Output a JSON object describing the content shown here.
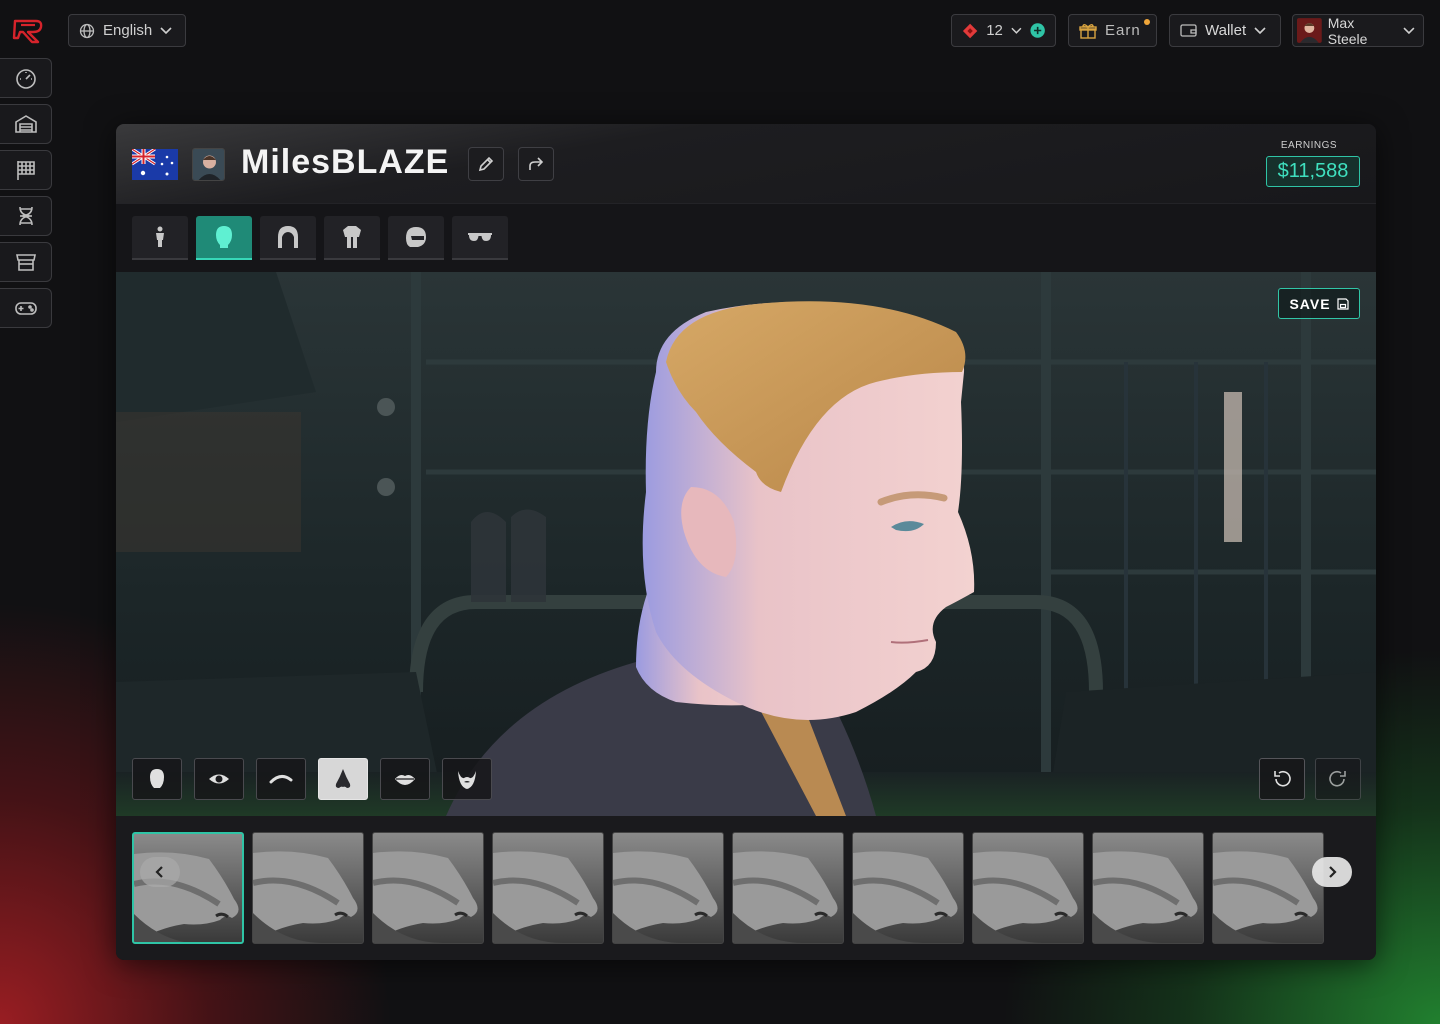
{
  "language": {
    "label": "English"
  },
  "tickets": {
    "count": "12"
  },
  "earn_button": {
    "label": "Earn"
  },
  "wallet_button": {
    "label": "Wallet"
  },
  "user": {
    "name": "Max Steele"
  },
  "profile": {
    "name": "MilesBLAZE",
    "earnings_label": "EARNINGS",
    "earnings_value": "$11,588"
  },
  "sidebar": {
    "items": [
      {
        "icon": "dashboard-gauge-icon"
      },
      {
        "icon": "garage-icon"
      },
      {
        "icon": "racing-flag-icon"
      },
      {
        "icon": "dna-icon"
      },
      {
        "icon": "store-icon"
      },
      {
        "icon": "gamepad-icon"
      }
    ]
  },
  "category_tabs": [
    {
      "icon": "body-icon",
      "active": false
    },
    {
      "icon": "head-icon",
      "active": true
    },
    {
      "icon": "hair-icon",
      "active": false
    },
    {
      "icon": "suit-icon",
      "active": false
    },
    {
      "icon": "helmet-icon",
      "active": false
    },
    {
      "icon": "glasses-icon",
      "active": false
    }
  ],
  "viewport": {
    "save_label": "SAVE"
  },
  "face_parts": [
    {
      "icon": "face-shape-icon",
      "active": false
    },
    {
      "icon": "eye-icon",
      "active": false
    },
    {
      "icon": "eyebrow-icon",
      "active": false
    },
    {
      "icon": "nose-icon",
      "active": true
    },
    {
      "icon": "lips-icon",
      "active": false
    },
    {
      "icon": "beard-icon",
      "active": false
    }
  ],
  "nose_options": {
    "selected_index": 0,
    "count": 10
  },
  "colors": {
    "accent": "#2fc4a6",
    "earnings_text": "#3fe0bf",
    "brand_red": "#d6232b"
  }
}
